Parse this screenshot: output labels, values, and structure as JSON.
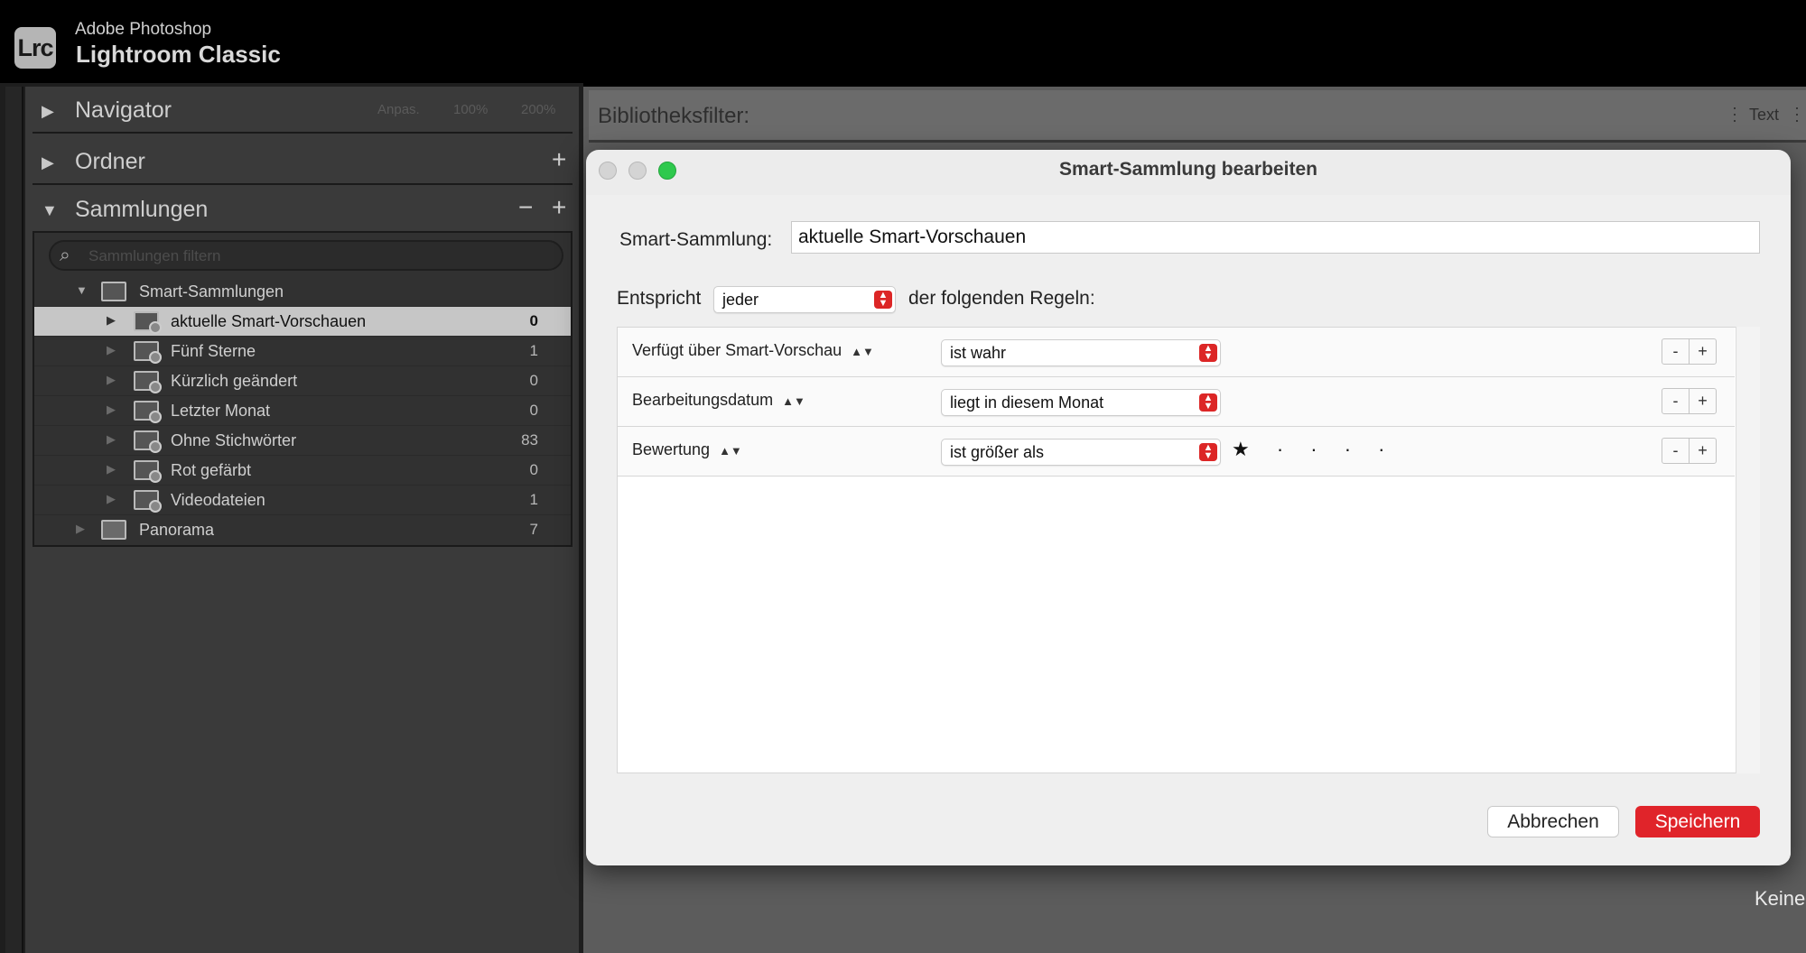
{
  "app": {
    "logo_text": "Lrc",
    "name_line1": "Adobe Photoshop",
    "name_line2": "Lightroom Classic"
  },
  "left_panel": {
    "navigator": {
      "title": "Navigator",
      "zoom_options": [
        "Anpas.",
        "100%",
        "200%"
      ]
    },
    "folders": {
      "title": "Ordner",
      "add_symbol": "+"
    },
    "collections": {
      "title": "Sammlungen",
      "remove_symbol": "−",
      "add_symbol": "+",
      "search_placeholder": "Sammlungen filtern",
      "items": [
        {
          "label": "Smart-Sammlungen",
          "count": ""
        },
        {
          "label": "aktuelle Smart-Vorschauen",
          "count": "0",
          "selected": true
        },
        {
          "label": "Fünf Sterne",
          "count": "1"
        },
        {
          "label": "Kürzlich geändert",
          "count": "0"
        },
        {
          "label": "Letzter Monat",
          "count": "0"
        },
        {
          "label": "Ohne Stichwörter",
          "count": "83"
        },
        {
          "label": "Rot gefärbt",
          "count": "0"
        },
        {
          "label": "Videodateien",
          "count": "1"
        },
        {
          "label": "Panorama",
          "count": "7"
        }
      ]
    }
  },
  "filter_bar": {
    "label": "Bibliotheksfilter:",
    "text_tab": "Text"
  },
  "status": {
    "keine": "Keine"
  },
  "dialog": {
    "title": "Smart-Sammlung bearbeiten",
    "name_label": "Smart-Sammlung:",
    "name_value": "aktuelle Smart-Vorschauen",
    "match_label": "Entspricht",
    "match_value": "jeder",
    "match_suffix": "der folgenden Regeln:",
    "rules": [
      {
        "field": "Verfügt über Smart-Vorschau",
        "operator": "ist wahr",
        "value": ""
      },
      {
        "field": "Bearbeitungsdatum",
        "operator": "liegt in diesem Monat",
        "value": ""
      },
      {
        "field": "Bewertung",
        "operator": "ist größer als",
        "value": "★ · · · ·",
        "rating": 1
      }
    ],
    "minus_symbol": "-",
    "plus_symbol": "+",
    "cancel_label": "Abbrechen",
    "save_label": "Speichern"
  },
  "colors": {
    "accent_red": "#e0242a",
    "zoom_green": "#2ec94d",
    "selected_row": "#c6c6c6"
  },
  "icons": {
    "expand": "triangle-right-icon",
    "collapse": "triangle-down-icon",
    "search": "search-icon",
    "smart_collection": "smart-collection-icon",
    "collection_set": "collection-set-icon",
    "select_arrows": "select-arrows-icon",
    "sort": "up-down-arrows-icon"
  }
}
